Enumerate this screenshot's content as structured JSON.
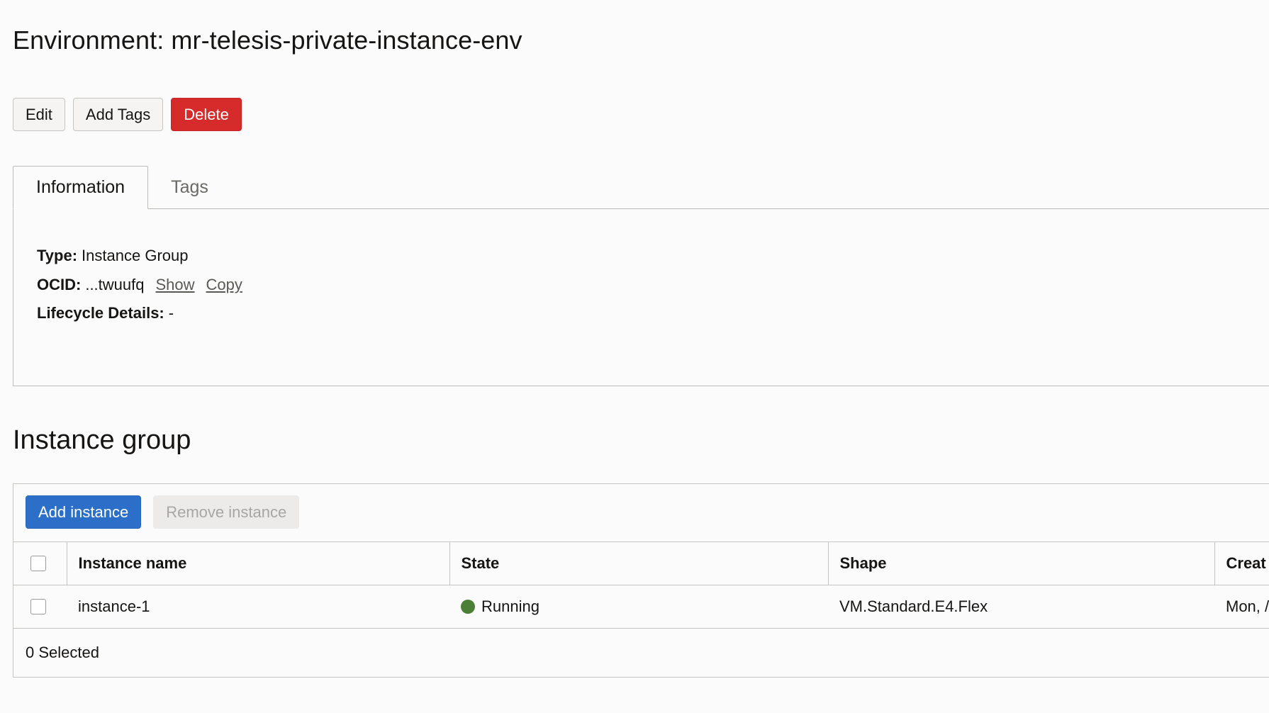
{
  "header": {
    "title": "Environment: mr-telesis-private-instance-env"
  },
  "actions": {
    "edit": "Edit",
    "add_tags": "Add Tags",
    "delete": "Delete"
  },
  "colors": {
    "danger": "#d52b2b",
    "primary": "#2c6fc8",
    "running": "#4b7e36"
  },
  "tabs": [
    {
      "label": "Information",
      "active": true
    },
    {
      "label": "Tags",
      "active": false
    }
  ],
  "info": {
    "type_label": "Type:",
    "type_value": "Instance Group",
    "ocid_label": "OCID:",
    "ocid_value": "...twuufq",
    "show_link": "Show",
    "copy_link": "Copy",
    "lifecycle_label": "Lifecycle Details:",
    "lifecycle_value": "-"
  },
  "instance_group": {
    "title": "Instance group",
    "add_button": "Add instance",
    "remove_button": "Remove instance",
    "columns": [
      "Instance name",
      "State",
      "Shape",
      "Creat"
    ],
    "rows": [
      {
        "name": "instance-1",
        "state": "Running",
        "shape": "VM.Standard.E4.Flex",
        "created": "Mon, /"
      }
    ],
    "selected_text": "0 Selected"
  }
}
